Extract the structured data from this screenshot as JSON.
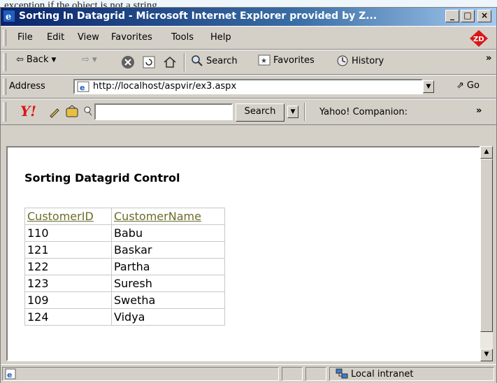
{
  "doc_text": "exception if the object is not a string.",
  "window": {
    "title": "Sorting In Datagrid - Microsoft Internet Explorer provided by Z..."
  },
  "title_buttons": {
    "minimize": "_",
    "maximize": "□",
    "close": "×"
  },
  "menu": [
    {
      "label": "File"
    },
    {
      "label": "Edit"
    },
    {
      "label": "View"
    },
    {
      "label": "Favorites"
    },
    {
      "label": "Tools"
    },
    {
      "label": "Help"
    }
  ],
  "toolbar": {
    "back": "Back",
    "search": "Search",
    "favorites": "Favorites",
    "history": "History",
    "chevron": "»"
  },
  "address": {
    "label": "Address",
    "value": "http://localhost/aspvir/ex3.aspx",
    "go": "Go"
  },
  "yahoo": {
    "logo": "Y!",
    "search_button": "Search",
    "companion": "Yahoo! Companion:",
    "chevron": "»",
    "search_value": ""
  },
  "page": {
    "heading": "Sorting Datagrid Control",
    "columns": [
      "CustomerID",
      "CustomerName"
    ],
    "rows": [
      [
        "110",
        "Babu"
      ],
      [
        "121",
        "Baskar"
      ],
      [
        "122",
        "Partha"
      ],
      [
        "123",
        "Suresh"
      ],
      [
        "109",
        "Swetha"
      ],
      [
        "124",
        "Vidya"
      ]
    ]
  },
  "status": {
    "zone": "Local intranet"
  },
  "colors": {
    "title_start": "#0a246a",
    "title_end": "#a6caf0",
    "header_link": "#6b6b2a",
    "chrome": "#d4d0c8"
  }
}
